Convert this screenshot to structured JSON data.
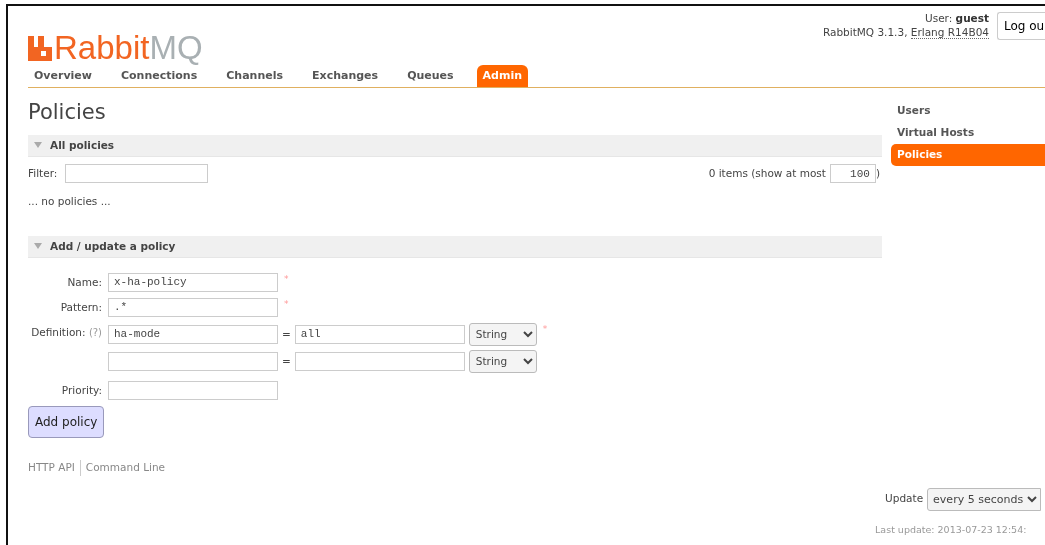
{
  "header": {
    "logo_main": "Rabbit",
    "logo_suffix": "MQ",
    "user_label": "User: ",
    "user": "guest",
    "version": "RabbitMQ 3.1.3, ",
    "erlang": "Erlang R14B04",
    "logout": "Log ou"
  },
  "tabs": [
    {
      "label": "Overview",
      "selected": false
    },
    {
      "label": "Connections",
      "selected": false
    },
    {
      "label": "Channels",
      "selected": false
    },
    {
      "label": "Exchanges",
      "selected": false
    },
    {
      "label": "Queues",
      "selected": false
    },
    {
      "label": "Admin",
      "selected": true
    }
  ],
  "page_title": "Policies",
  "all_policies": {
    "title": "All policies",
    "expanded": true,
    "filter_label": "Filter:",
    "count_text": "0 items (show at most",
    "limit": "100",
    "close_paren": ")",
    "empty_text": "... no policies ..."
  },
  "add_policy": {
    "title": "Add / update a policy",
    "expanded": true,
    "fields": [
      {
        "label": "Name:",
        "value": "x-ha-policy",
        "required_mark": "*"
      },
      {
        "label": "Pattern:",
        "value": ".*",
        "required_mark": "*"
      }
    ],
    "definition": {
      "label": "Definition:",
      "help": "(?)",
      "required_mark": "*",
      "rows": [
        {
          "key": "ha-mode",
          "equals": "=",
          "value": "all",
          "type": "String"
        },
        {
          "key": "",
          "equals": "=",
          "value": "",
          "type": "String"
        }
      ]
    },
    "priority": {
      "label": "Priority:"
    },
    "button": "Add policy"
  },
  "footer_links": [
    "HTTP API",
    "Command Line"
  ],
  "sidebar": {
    "items": [
      {
        "label": "Users",
        "selected": false
      },
      {
        "label": "Virtual Hosts",
        "selected": false
      },
      {
        "label": "Policies",
        "selected": true
      }
    ],
    "update_label": "Update",
    "update_value": "every 5 seconds",
    "last_update": "Last update: 2013-07-23 12:54:"
  }
}
